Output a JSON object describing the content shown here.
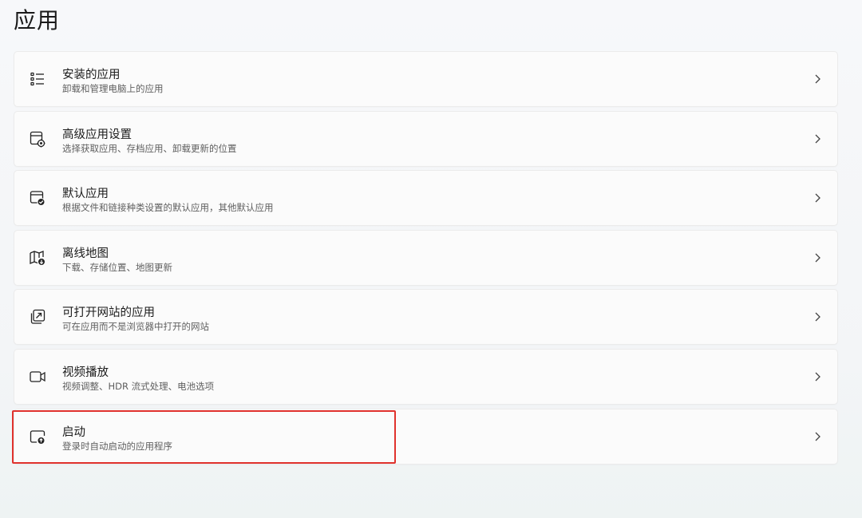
{
  "page": {
    "title": "应用"
  },
  "items": [
    {
      "title": "安装的应用",
      "desc": "卸载和管理电脑上的应用",
      "icon": "app-list-icon"
    },
    {
      "title": "高级应用设置",
      "desc": "选择获取应用、存档应用、卸载更新的位置",
      "icon": "app-settings-icon"
    },
    {
      "title": "默认应用",
      "desc": "根据文件和链接种类设置的默认应用，其他默认应用",
      "icon": "default-apps-icon"
    },
    {
      "title": "离线地图",
      "desc": "下载、存储位置、地图更新",
      "icon": "map-download-icon"
    },
    {
      "title": "可打开网站的应用",
      "desc": "可在应用而不是浏览器中打开的网站",
      "icon": "open-external-icon"
    },
    {
      "title": "视频播放",
      "desc": "视频调整、HDR 流式处理、电池选项",
      "icon": "video-camera-icon"
    },
    {
      "title": "启动",
      "desc": "登录时自动启动的应用程序",
      "icon": "startup-icon"
    }
  ],
  "colors": {
    "highlight": "#e0322d",
    "card_bg": "#fbfbfb",
    "card_border": "#ebebeb"
  }
}
